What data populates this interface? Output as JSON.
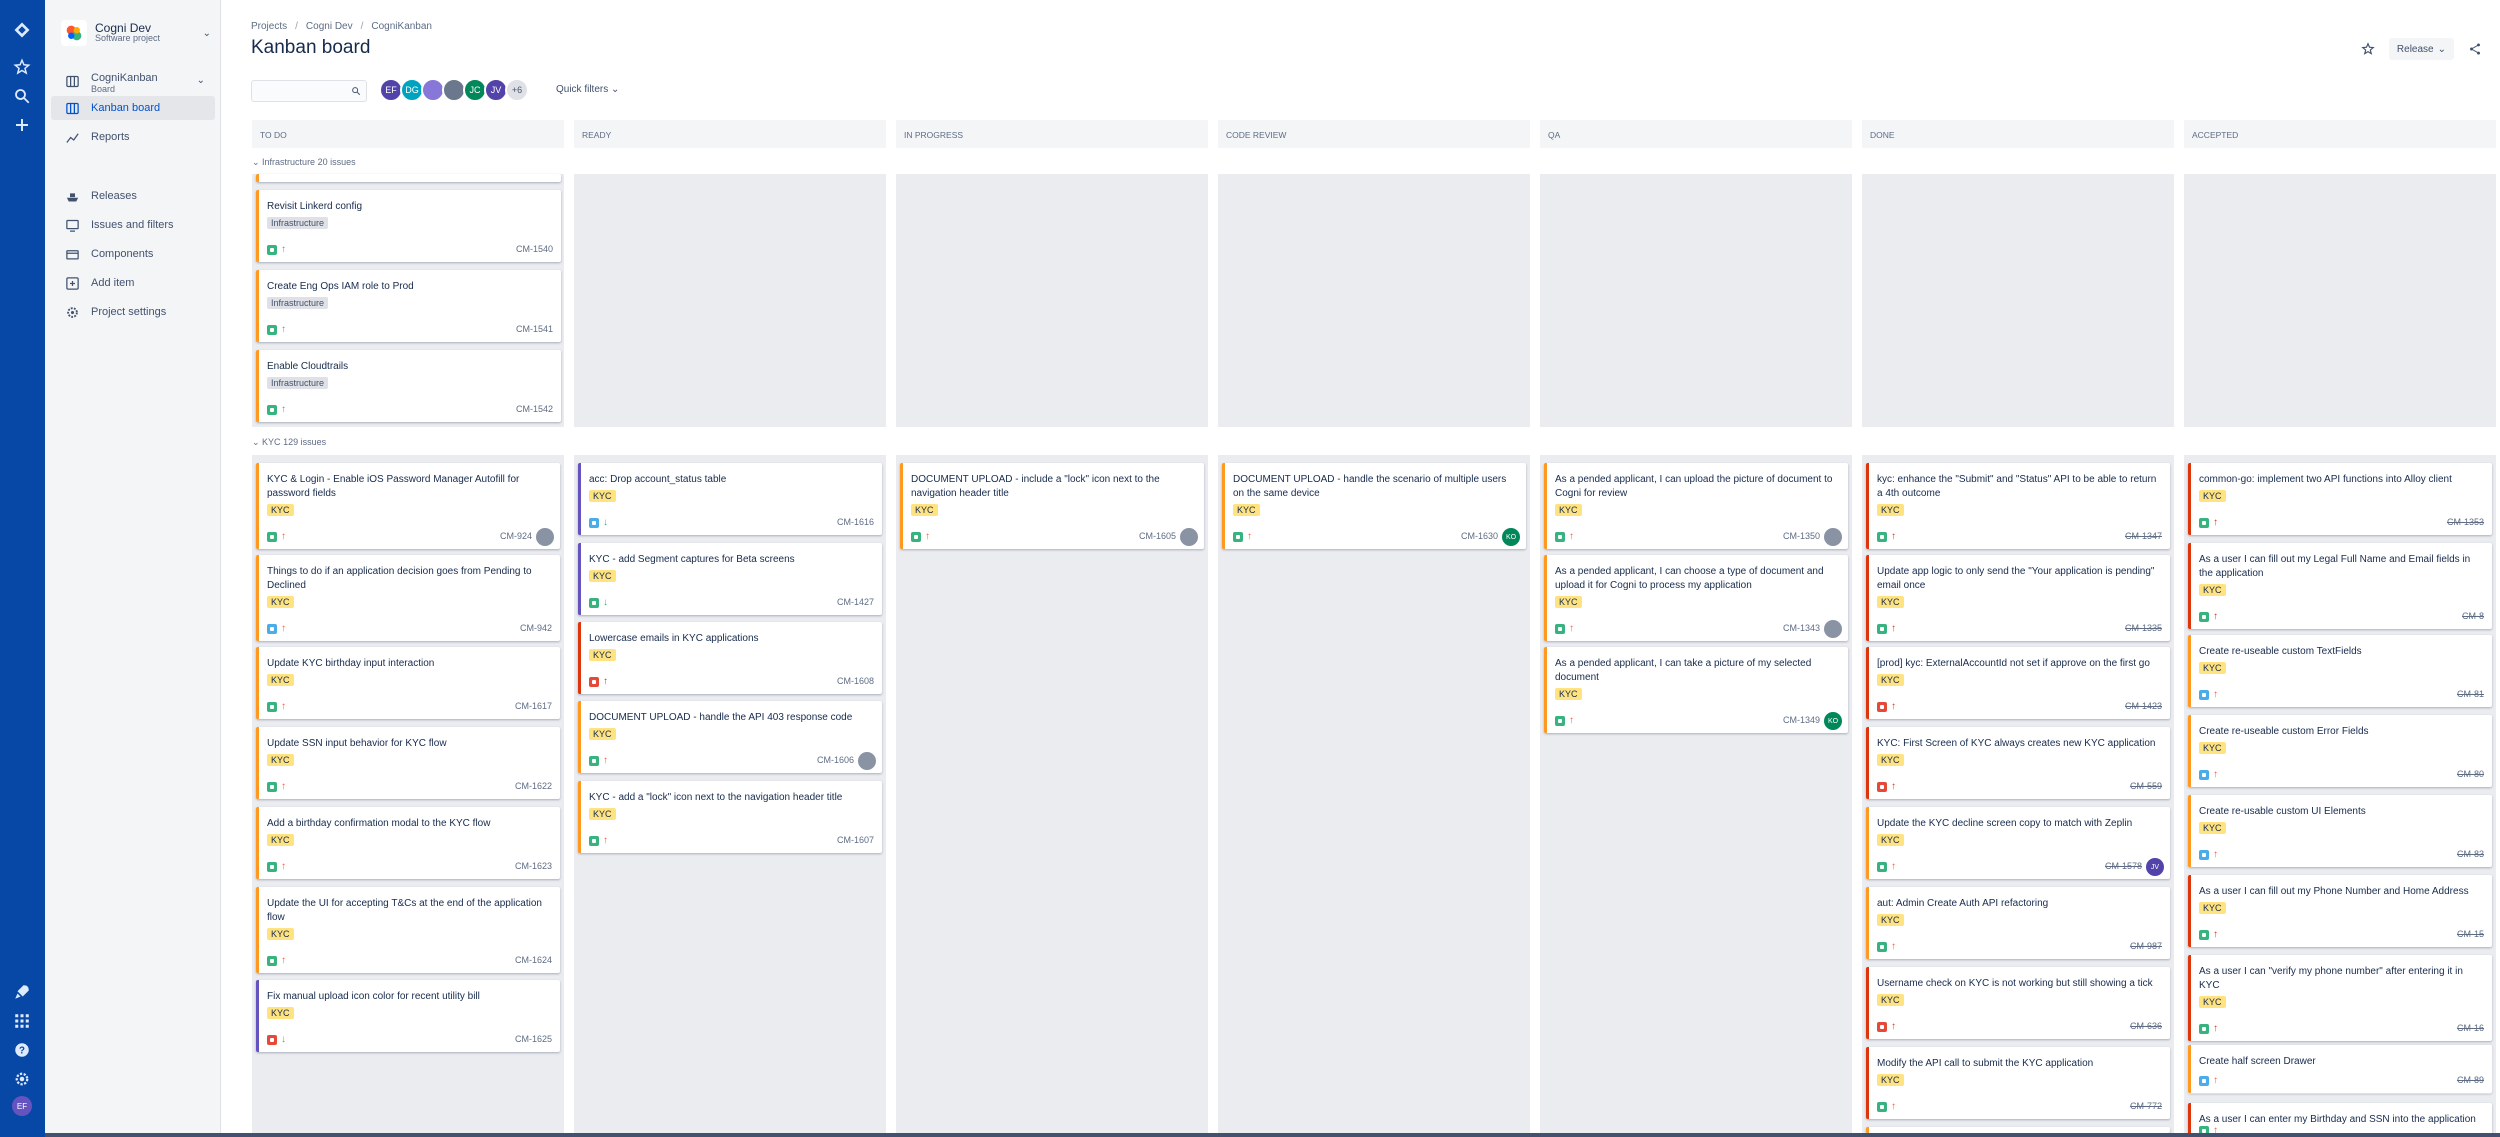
{
  "sidebar": {
    "project_name": "Cogni Dev",
    "project_type": "Software project",
    "board_name": "CogniKanban",
    "board_sub": "Board",
    "items": [
      {
        "label": "Kanban board",
        "icon": "board-icon"
      },
      {
        "label": "Reports",
        "icon": "chart-icon"
      },
      {
        "label": "Releases",
        "icon": "ship-icon"
      },
      {
        "label": "Issues and filters",
        "icon": "filter-icon"
      },
      {
        "label": "Components",
        "icon": "component-icon"
      },
      {
        "label": "Add item",
        "icon": "add-item-icon"
      },
      {
        "label": "Project settings",
        "icon": "gear-icon"
      }
    ]
  },
  "rail": {
    "user_initials": "EF"
  },
  "header": {
    "breadcrumbs": [
      "Projects",
      "Cogni Dev",
      "CogniKanban"
    ],
    "title": "Kanban board",
    "release_label": "Release",
    "quick_filters": "Quick filters"
  },
  "avatars": [
    {
      "initials": "EF",
      "color": "#5243aa"
    },
    {
      "initials": "DG",
      "color": "#00a3bf"
    },
    {
      "initials": "",
      "color": "#8777d9"
    },
    {
      "initials": "",
      "color": "#6b778c"
    },
    {
      "initials": "JC",
      "color": "#00875a"
    },
    {
      "initials": "JV",
      "color": "#5243aa"
    },
    {
      "initials": "+6",
      "color": "#dfe1e6"
    }
  ],
  "columns": [
    "TO DO",
    "READY",
    "IN PROGRESS",
    "CODE REVIEW",
    "QA",
    "DONE",
    "ACCEPTED"
  ],
  "swimlanes": [
    {
      "name": "Infrastructure",
      "count": "20 issues"
    },
    {
      "name": "KYC",
      "count": "129 issues"
    }
  ],
  "infra_cards": [
    {
      "title": "Revisit Linkerd config",
      "label": "Infrastructure",
      "key": "CM-1540"
    },
    {
      "title": "Create Eng Ops IAM role to Prod",
      "label": "Infrastructure",
      "key": "CM-1541"
    },
    {
      "title": "Enable Cloudtrails",
      "label": "Infrastructure",
      "key": "CM-1542"
    }
  ],
  "kyc": {
    "todo": [
      {
        "title": "KYC & Login - Enable iOS Password Manager Autofill for password fields",
        "label": "KYC",
        "key": "CM-924",
        "type": "story",
        "prio": "up",
        "avatar": "photo"
      },
      {
        "title": "Things to do if an application decision goes from Pending to Declined",
        "label": "KYC",
        "key": "CM-942",
        "type": "task",
        "prio": "up"
      },
      {
        "title": "Update KYC birthday input interaction",
        "label": "KYC",
        "key": "CM-1617",
        "type": "story",
        "prio": "up"
      },
      {
        "title": "Update SSN input behavior for KYC flow",
        "label": "KYC",
        "key": "CM-1622",
        "type": "story",
        "prio": "up"
      },
      {
        "title": "Add a birthday confirmation modal to the KYC flow",
        "label": "KYC",
        "key": "CM-1623",
        "type": "story",
        "prio": "up"
      },
      {
        "title": "Update the UI for accepting T&Cs at the end of the application flow",
        "label": "KYC",
        "key": "CM-1624",
        "type": "story",
        "prio": "up"
      },
      {
        "title": "Fix manual upload icon color for recent utility bill",
        "label": "KYC",
        "key": "CM-1625",
        "type": "bug",
        "prio": "down",
        "border": "purple"
      }
    ],
    "ready": [
      {
        "title": "acc: Drop account_status table",
        "label": "KYC",
        "key": "CM-1616",
        "type": "task",
        "prio": "down",
        "border": "purple"
      },
      {
        "title": "KYC - add Segment captures for Beta screens",
        "label": "KYC",
        "key": "CM-1427",
        "type": "story",
        "prio": "down",
        "border": "purple"
      },
      {
        "title": "Lowercase emails in KYC applications",
        "label": "KYC",
        "key": "CM-1608",
        "type": "bug",
        "prio": "upred",
        "border": "red"
      },
      {
        "title": "DOCUMENT UPLOAD - handle the API 403 response code",
        "label": "KYC",
        "key": "CM-1606",
        "type": "story",
        "prio": "up",
        "avatar": "photo"
      },
      {
        "title": "KYC - add a \"lock\" icon next to the navigation header title",
        "label": "KYC",
        "key": "CM-1607",
        "type": "story",
        "prio": "up"
      }
    ],
    "inprogress": [
      {
        "title": "DOCUMENT UPLOAD - include a \"lock\" icon next to the navigation header title",
        "label": "KYC",
        "key": "CM-1605",
        "type": "story",
        "prio": "up",
        "avatar": "photo"
      }
    ],
    "codereview": [
      {
        "title": "DOCUMENT UPLOAD - handle the scenario of multiple users on the same device",
        "label": "KYC",
        "key": "CM-1630",
        "type": "story",
        "prio": "up",
        "avatar": "KO"
      }
    ],
    "qa": [
      {
        "title": "As a pended applicant, I can upload the picture of document to Cogni for review",
        "label": "KYC",
        "key": "CM-1350",
        "type": "story",
        "prio": "up",
        "avatar": "photo"
      },
      {
        "title": "As a pended applicant, I can choose a type of document and upload it for Cogni to process my application",
        "label": "KYC",
        "key": "CM-1343",
        "type": "story",
        "prio": "up",
        "avatar": "photo"
      },
      {
        "title": "As a pended applicant, I can take a picture of my selected document",
        "label": "KYC",
        "key": "CM-1349",
        "type": "story",
        "prio": "up",
        "avatar": "KO"
      }
    ],
    "done": [
      {
        "title": "kyc: enhance the \"Submit\" and \"Status\" API to be able to return a 4th outcome",
        "label": "KYC",
        "key": "CM-1347",
        "type": "story",
        "prio": "upred",
        "border": "red"
      },
      {
        "title": "Update app logic to only send the \"Your application is pending\" email once",
        "label": "KYC",
        "key": "CM-1335",
        "type": "story",
        "prio": "upred",
        "border": "red"
      },
      {
        "title": "[prod] kyc: ExternalAccountId not set if approve on the first go",
        "label": "KYC",
        "key": "CM-1423",
        "type": "bug",
        "prio": "upred",
        "border": "red"
      },
      {
        "title": "KYC: First Screen of KYC always creates new KYC application",
        "label": "KYC",
        "key": "CM-559",
        "type": "bug",
        "prio": "upred",
        "border": "red"
      },
      {
        "title": "Update the KYC decline screen copy to match with Zeplin",
        "label": "KYC",
        "key": "CM-1578",
        "type": "story",
        "prio": "up",
        "avatar": "JV"
      },
      {
        "title": "aut: Admin Create Auth API refactoring",
        "label": "KYC",
        "key": "CM-987",
        "type": "story",
        "prio": "up"
      },
      {
        "title": "Username check on KYC is not working but still showing a tick",
        "label": "KYC",
        "key": "CM-636",
        "type": "bug",
        "prio": "upred",
        "border": "red"
      },
      {
        "title": "Modify the API call to submit the KYC application",
        "label": "KYC",
        "key": "CM-772",
        "type": "story",
        "prio": "up",
        "border": "red"
      }
    ],
    "accepted": [
      {
        "title": "common-go: implement two API functions into Alloy client",
        "label": "KYC",
        "key": "CM-1353",
        "type": "story",
        "prio": "upred",
        "border": "red"
      },
      {
        "title": "As a user I can fill out my Legal Full Name and Email fields in the application",
        "label": "KYC",
        "key": "CM-8",
        "type": "story",
        "prio": "upred",
        "border": "red"
      },
      {
        "title": "Create re-useable custom TextFields",
        "label": "KYC",
        "key": "CM-81",
        "type": "task",
        "prio": "up"
      },
      {
        "title": "Create re-useable custom Error Fields",
        "label": "KYC",
        "key": "CM-80",
        "type": "task",
        "prio": "up"
      },
      {
        "title": "Create re-usable custom UI Elements",
        "label": "KYC",
        "key": "CM-83",
        "type": "task",
        "prio": "up"
      },
      {
        "title": "As a user I can fill out my Phone Number and Home Address",
        "label": "KYC",
        "key": "CM-15",
        "type": "story",
        "prio": "upred",
        "border": "red"
      },
      {
        "title": "As a user I can \"verify my phone number\" after entering it in KYC",
        "label": "KYC",
        "key": "CM-16",
        "type": "story",
        "prio": "upred",
        "border": "red"
      },
      {
        "title": "Create half screen Drawer",
        "label": "",
        "key": "CM-89",
        "type": "task",
        "prio": "up"
      },
      {
        "title": "As a user I can enter my Birthday and SSN into the application",
        "label": "",
        "key": "",
        "type": "story",
        "prio": "up",
        "border": "red"
      }
    ]
  }
}
